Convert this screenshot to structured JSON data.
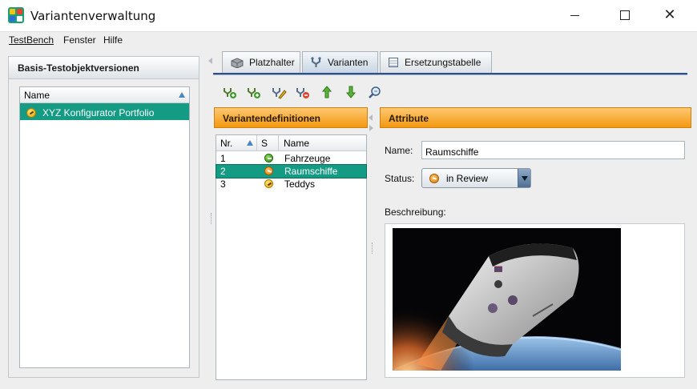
{
  "window": {
    "title": "Variantenverwaltung"
  },
  "menu": {
    "items": [
      "TestBench",
      "Fenster",
      "Hilfe"
    ]
  },
  "left_panel": {
    "title": "Basis-Testobjektversionen",
    "column": "Name",
    "rows": [
      {
        "label": "XYZ Konfigurator Portfolio",
        "status_icon": "status-in-progress-icon"
      }
    ]
  },
  "tabs": [
    {
      "label": "Platzhalter",
      "icon": "placeholder-icon"
    },
    {
      "label": "Varianten",
      "icon": "variants-icon"
    },
    {
      "label": "Ersetzungstabelle",
      "icon": "table-icon"
    }
  ],
  "toolbar": {
    "buttons": [
      "add-variant-icon",
      "add-variant-copy-icon",
      "edit-variant-icon",
      "delete-variant-icon",
      "move-up-icon",
      "move-down-icon",
      "search-icon"
    ]
  },
  "variant_panel": {
    "title": "Variantendefinitionen",
    "columns": [
      "Nr.",
      "S",
      "Name"
    ],
    "rows": [
      {
        "nr": "1",
        "name": "Fahrzeuge",
        "status": "green"
      },
      {
        "nr": "2",
        "name": "Raumschiffe",
        "status": "orange"
      },
      {
        "nr": "3",
        "name": "Teddys",
        "status": "yellow"
      }
    ]
  },
  "attributes": {
    "title": "Attribute",
    "name_label": "Name:",
    "name_value": "Raumschiffe",
    "status_label": "Status:",
    "status_value": "in Review",
    "description_label": "Beschreibung:"
  },
  "colors": {
    "selection": "#139b84",
    "header_orange": "#f2980f",
    "accent_blue": "#2d4f8d"
  }
}
